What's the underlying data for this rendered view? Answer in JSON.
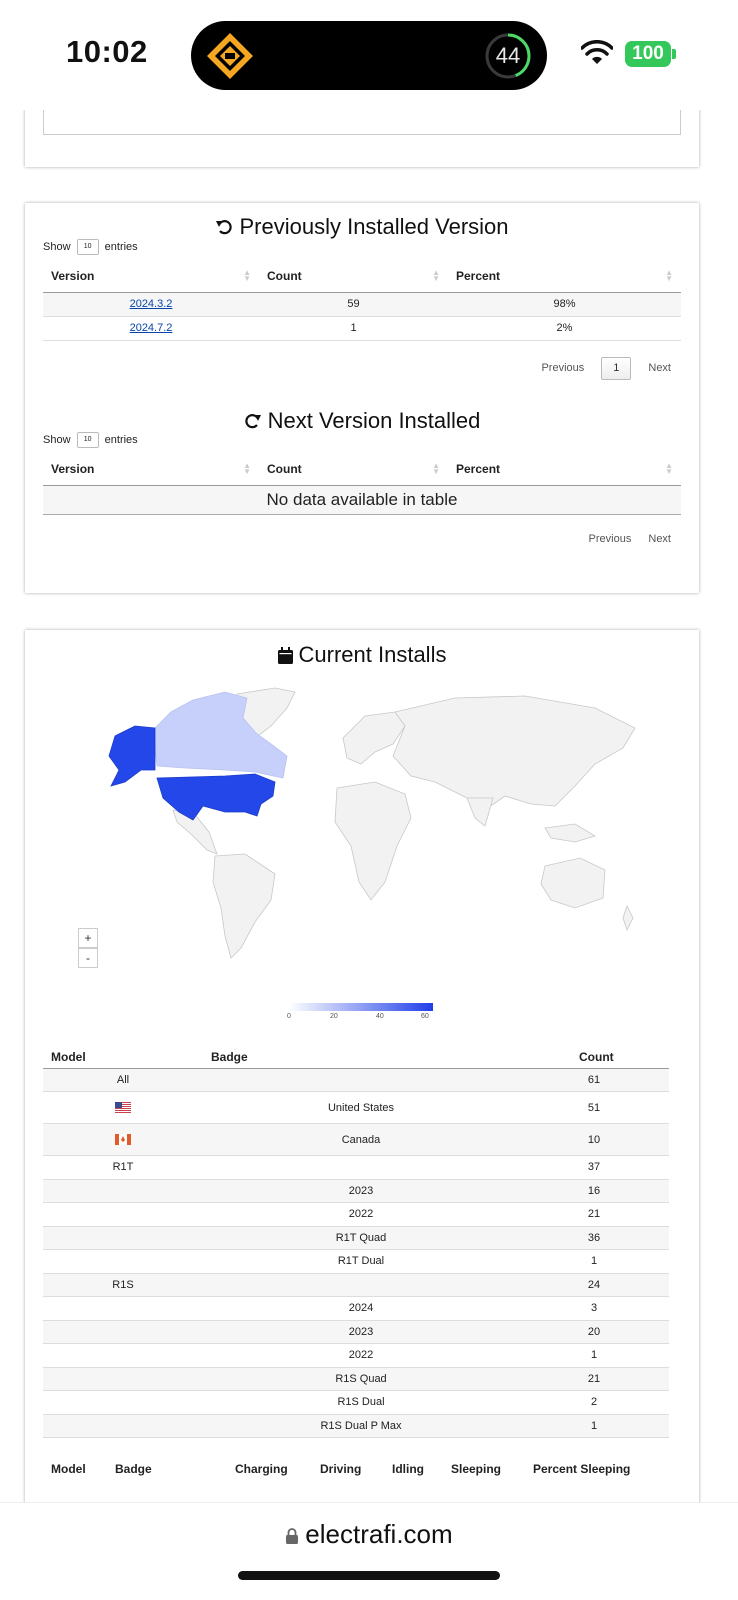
{
  "status": {
    "time": "10:02",
    "activity_number": "44",
    "battery": "100"
  },
  "previously_installed": {
    "title": "Previously Installed Version",
    "show_label": "Show",
    "entries_value": "10",
    "entries_label": "entries",
    "headers": [
      "Version",
      "Count",
      "Percent"
    ],
    "rows": [
      {
        "version": "2024.3.2",
        "count": "59",
        "percent": "98%"
      },
      {
        "version": "2024.7.2",
        "count": "1",
        "percent": "2%"
      }
    ],
    "pager": {
      "previous": "Previous",
      "page": "1",
      "next": "Next"
    }
  },
  "next_installed": {
    "title": "Next Version Installed",
    "show_label": "Show",
    "entries_value": "10",
    "entries_label": "entries",
    "headers": [
      "Version",
      "Count",
      "Percent"
    ],
    "empty_text": "No data available in table",
    "pager": {
      "previous": "Previous",
      "next": "Next"
    }
  },
  "current_installs": {
    "title": "Current Installs",
    "map": {
      "zoom_in": "+",
      "zoom_out": "-",
      "legend_ticks": [
        "0",
        "20",
        "40",
        "60"
      ],
      "scale_min_color": "#ffffff",
      "scale_max_color": "#1f3fe8",
      "country_values": {
        "United States": 51,
        "Canada": 10
      }
    },
    "headers": [
      "Model",
      "Badge",
      "Count"
    ],
    "rows": [
      {
        "model": "All",
        "badge": "",
        "count": "61"
      },
      {
        "model": "",
        "badge": "United States",
        "count": "51",
        "flag": "us-flag"
      },
      {
        "model": "",
        "badge": "Canada",
        "count": "10",
        "flag": "ca-flag"
      },
      {
        "model": "R1T",
        "badge": "",
        "count": "37"
      },
      {
        "model": "",
        "badge": "2023",
        "count": "16"
      },
      {
        "model": "",
        "badge": "2022",
        "count": "21"
      },
      {
        "model": "",
        "badge": "R1T Quad",
        "count": "36"
      },
      {
        "model": "",
        "badge": "R1T Dual",
        "count": "1"
      },
      {
        "model": "R1S",
        "badge": "",
        "count": "24"
      },
      {
        "model": "",
        "badge": "2024",
        "count": "3"
      },
      {
        "model": "",
        "badge": "2023",
        "count": "20"
      },
      {
        "model": "",
        "badge": "2022",
        "count": "1"
      },
      {
        "model": "",
        "badge": "R1S Quad",
        "count": "21"
      },
      {
        "model": "",
        "badge": "R1S Dual",
        "count": "2"
      },
      {
        "model": "",
        "badge": "R1S Dual P Max",
        "count": "1"
      }
    ],
    "next_table_headers": [
      "Model",
      "Badge",
      "Charging",
      "Driving",
      "Idling",
      "Sleeping",
      "Percent Sleeping"
    ]
  },
  "browser": {
    "url": "electrafi.com"
  }
}
